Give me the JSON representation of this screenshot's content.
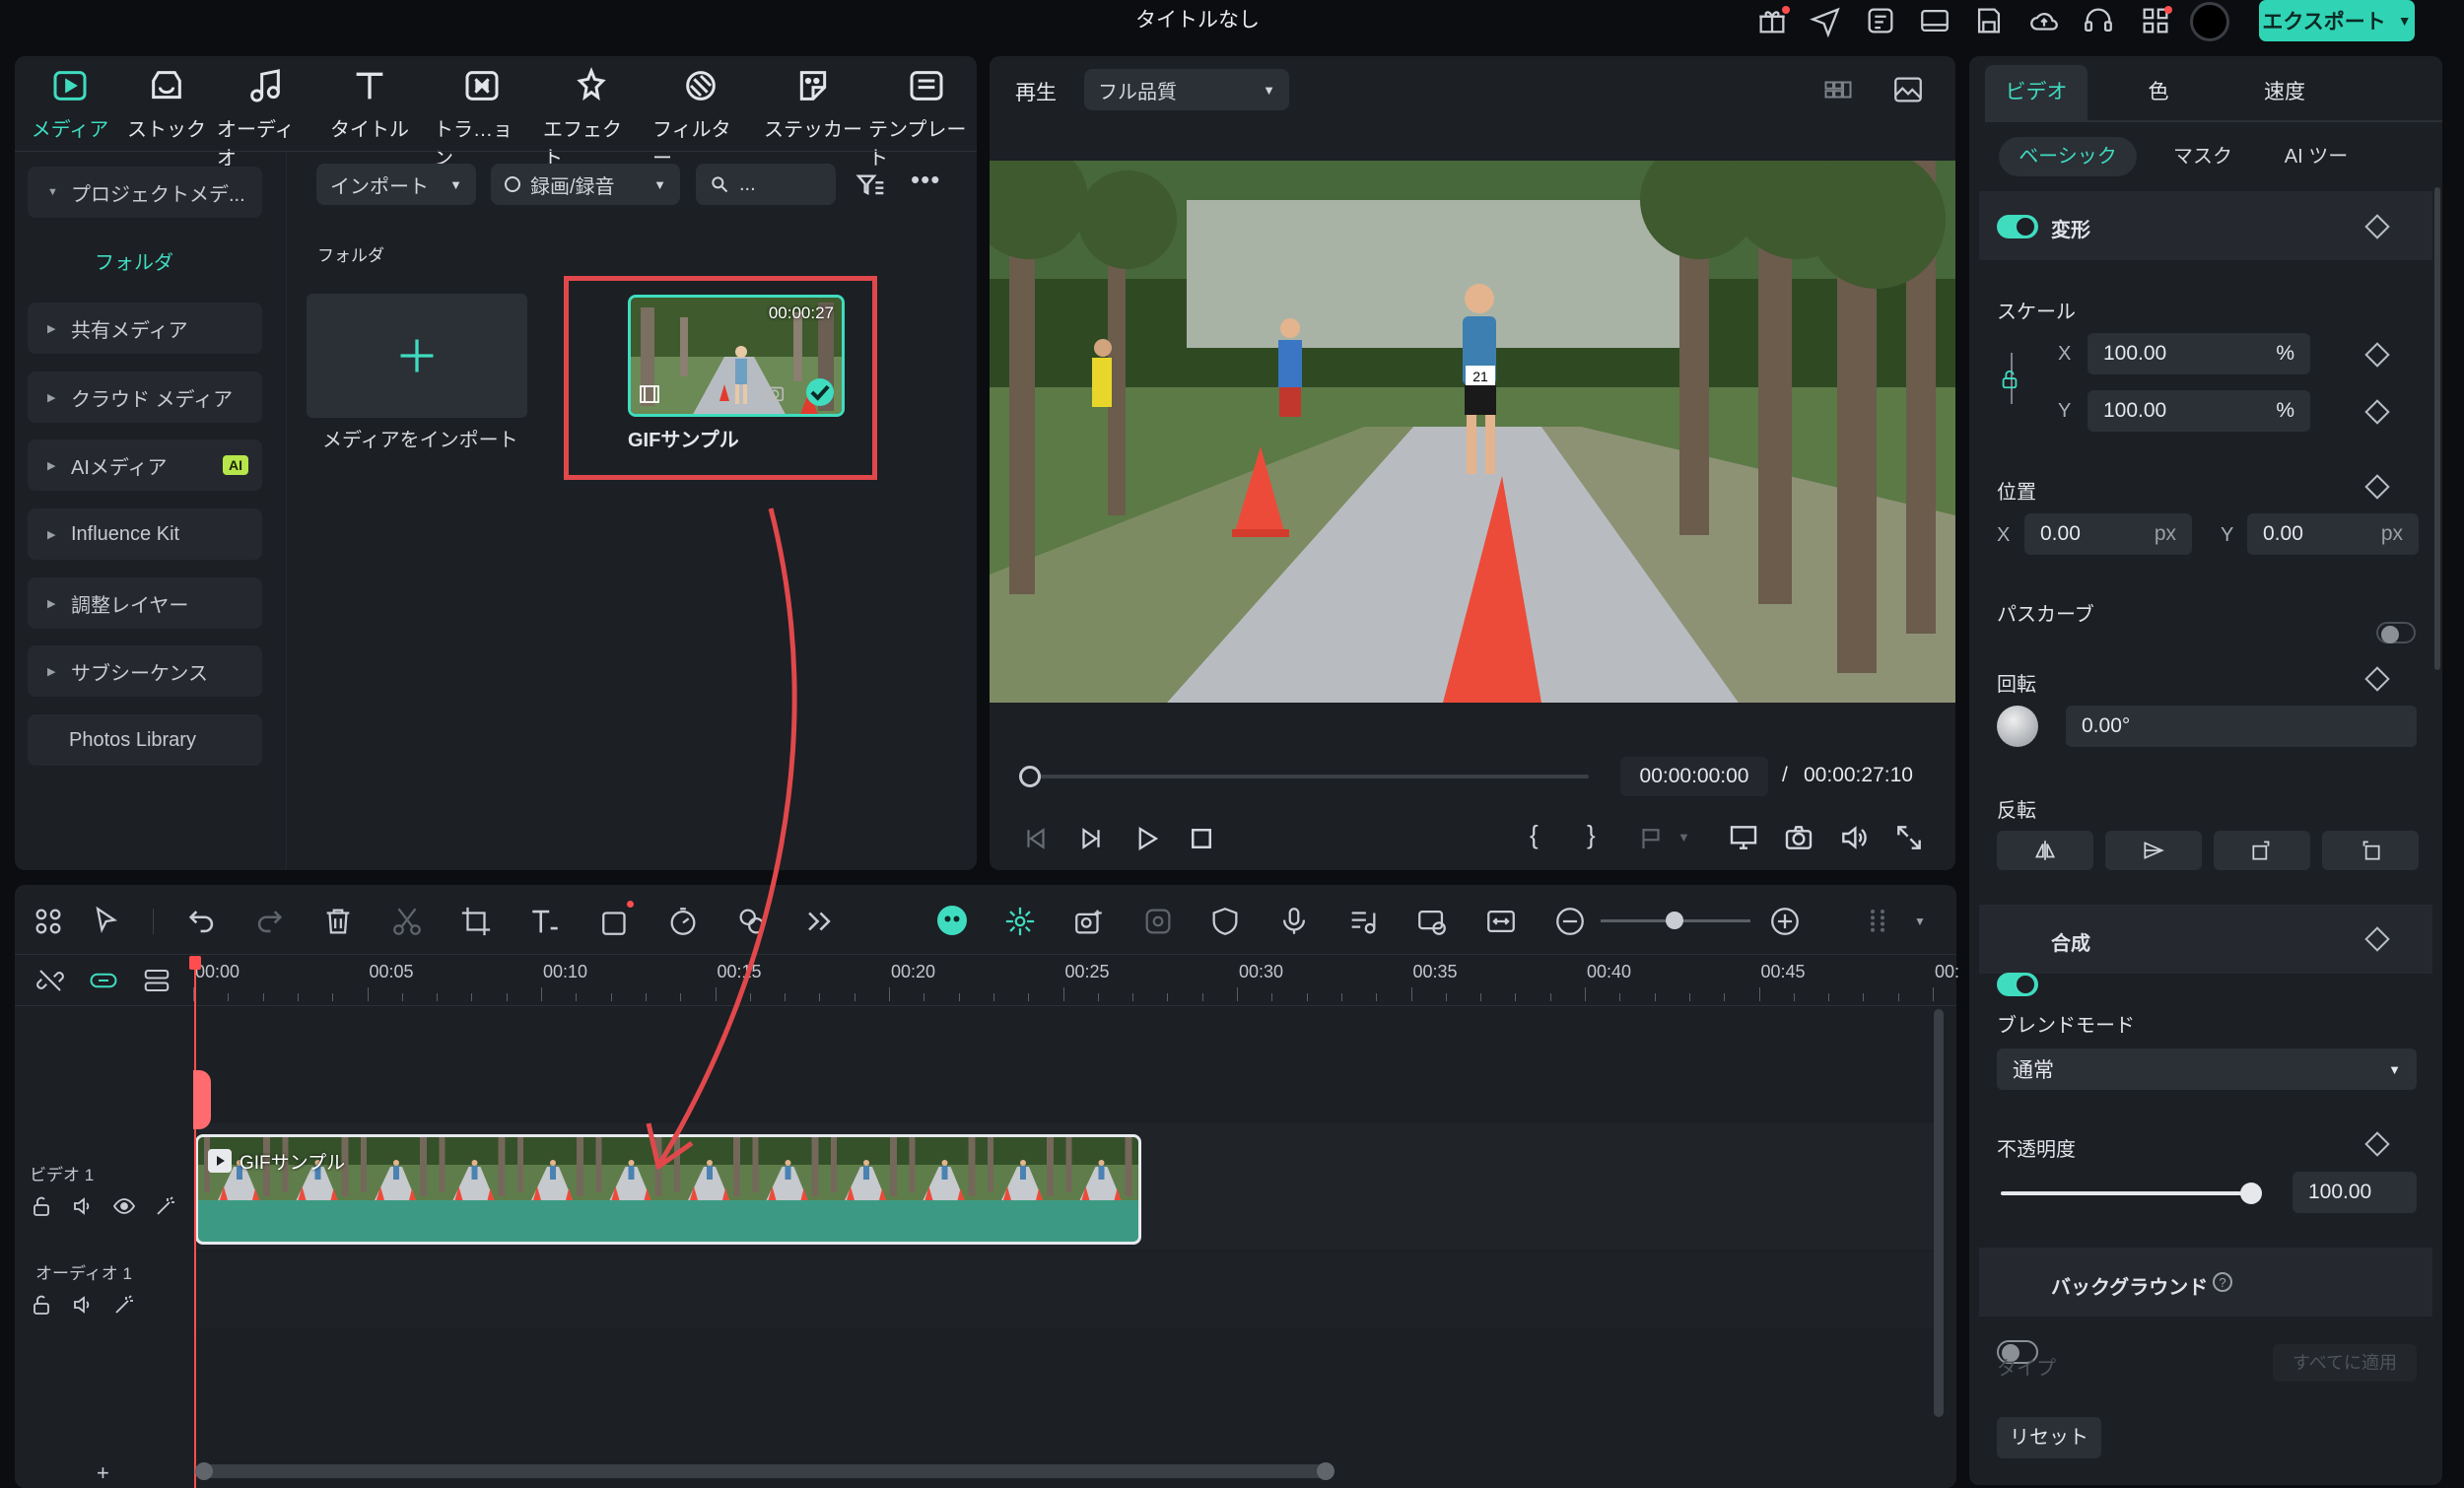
{
  "window": {
    "title": "タイトルなし"
  },
  "topbar": {
    "export_label": "エクスポート"
  },
  "media_tabs": [
    {
      "label": "メディア",
      "icon": "media-icon"
    },
    {
      "label": "ストック",
      "icon": "stock-icon"
    },
    {
      "label": "オーディオ",
      "icon": "music-note-icon"
    },
    {
      "label": "タイトル",
      "icon": "title-t-icon"
    },
    {
      "label": "トラ…ョン",
      "icon": "transition-icon"
    },
    {
      "label": "エフェクト",
      "icon": "effect-icon"
    },
    {
      "label": "フィルター",
      "icon": "filter-icon"
    },
    {
      "label": "ステッカー",
      "icon": "sticker-icon"
    },
    {
      "label": "テンプレート",
      "icon": "template-icon"
    }
  ],
  "media_toolbar": {
    "import_label": "インポート",
    "record_label": "録画/録音",
    "search_placeholder": "..."
  },
  "sidebar": {
    "project_media": "プロジェクトメデ...",
    "folder": "フォルダ",
    "items": [
      {
        "label": "共有メディア"
      },
      {
        "label": "クラウド メディア"
      },
      {
        "label": "AIメディア",
        "badge": "AI"
      },
      {
        "label": "Influence Kit"
      },
      {
        "label": "調整レイヤー"
      },
      {
        "label": "サブシーケンス"
      },
      {
        "label": "Photos Library"
      }
    ]
  },
  "media_area": {
    "folder_label": "フォルダ",
    "import_tile_label": "メディアをインポート",
    "clip": {
      "name": "GIFサンプル",
      "duration": "00:00:27"
    }
  },
  "preview": {
    "play_label": "再生",
    "quality_label": "フル品質",
    "current_time": "00:00:00:00",
    "separator": "/",
    "total_time": "00:00:27:10",
    "bib_number": "21"
  },
  "properties": {
    "tabs": [
      "ビデオ",
      "色",
      "速度"
    ],
    "subtabs": [
      "ベーシック",
      "マスク",
      "AI ツー"
    ],
    "transform_label": "変形",
    "scale_label": "スケール",
    "scale_x": "100.00",
    "scale_y": "100.00",
    "percent": "%",
    "x_label": "X",
    "y_label": "Y",
    "position_label": "位置",
    "pos_x": "0.00",
    "pos_y": "0.00",
    "px_unit": "px",
    "path_curve_label": "パスカーブ",
    "rotation_label": "回転",
    "rotation_value": "0.00°",
    "flip_label": "反転",
    "composite_label": "合成",
    "blend_mode_label": "ブレンドモード",
    "blend_mode_value": "通常",
    "opacity_label": "不透明度",
    "opacity_value": "100.00",
    "opacity_level": 1.0,
    "background_label": "バックグラウンド",
    "type_label": "タイプ",
    "apply_all_label": "すべてに適用",
    "reset_label": "リセット"
  },
  "timeline": {
    "ruler": [
      "00:00",
      "00:05",
      "00:10",
      "00:15",
      "00:20",
      "00:25",
      "00:30",
      "00:35",
      "00:40",
      "00:45",
      "00:"
    ],
    "video_track_label": "ビデオ 1",
    "audio_track_label": "オーディオ 1",
    "clip_label": "GIFサンプル",
    "add_track": "+"
  },
  "colors": {
    "accent": "#3fdcc0",
    "highlight_red": "#e1484b",
    "panel": "#1c1f24",
    "clip_green": "#3c9a84"
  }
}
